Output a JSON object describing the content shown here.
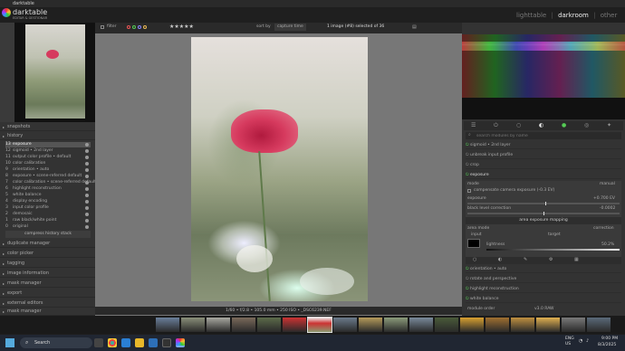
{
  "window": {
    "title": "darktable"
  },
  "app": {
    "name": "darktable",
    "subtitle": "EDITAR & GESTIONAR"
  },
  "views": [
    "lighttable",
    "darkroom",
    "other"
  ],
  "filterbar": {
    "filter_label": "filter",
    "stars": "★★★★★",
    "sort_label": "sort by",
    "sort_value": "capture time",
    "count_text": "1 image (#8) selected of 36"
  },
  "left_panel": {
    "snapshots": "snapshots",
    "history": "history",
    "history_items": [
      {
        "num": "13",
        "label": "exposure"
      },
      {
        "num": "12",
        "label": "sigmoid • 2nd layer"
      },
      {
        "num": "11",
        "label": "output color profile • default"
      },
      {
        "num": "10",
        "label": "color calibration"
      },
      {
        "num": "9",
        "label": "orientation • auto"
      },
      {
        "num": "8",
        "label": "exposure • scene-referred default"
      },
      {
        "num": "7",
        "label": "color calibration • scene-referred default"
      },
      {
        "num": "6",
        "label": "highlight reconstruction"
      },
      {
        "num": "5",
        "label": "white balance"
      },
      {
        "num": "4",
        "label": "display encoding"
      },
      {
        "num": "3",
        "label": "input color profile"
      },
      {
        "num": "2",
        "label": "demosaic"
      },
      {
        "num": "1",
        "label": "raw black/white point"
      },
      {
        "num": "0",
        "label": "original"
      }
    ],
    "compress_button": "compress history stack",
    "modules": [
      "duplicate manager",
      "color picker",
      "tagging",
      "image information",
      "mask manager",
      "export",
      "external editors",
      "mask manager"
    ]
  },
  "right_panel": {
    "search_placeholder": "search modules by name",
    "modules_top": [
      "sigmoid • 2nd layer",
      "unbreak input profile",
      "crop",
      "exposure"
    ],
    "exposure": {
      "mode_label": "mode",
      "mode_value": "manual",
      "compensate_label": "compensate camera exposure (-0.3 EV)",
      "exposure_label": "exposure",
      "exposure_value": "+0.700 EV",
      "black_label": "black level correction",
      "black_value": "-0.0002",
      "area_header": "area exposure mapping",
      "area_mode_label": "area mode",
      "area_mode_value": "correction",
      "input_label": "input",
      "target_label": "target",
      "lightness_label": "lightness",
      "lightness_value": "50.2%"
    },
    "modules_bottom": [
      "orientation • auto",
      "rotate and perspective",
      "highlight reconstruction",
      "white balance"
    ],
    "module_order_label": "module order",
    "module_order_value": "v3.0 RAW"
  },
  "infobar": {
    "text": "1/60 • f/2.8 • 105.0 mm • 250 ISO • _DSC6239.NEF"
  },
  "taskbar": {
    "search_label": "Search",
    "lang": "ENG",
    "region": "US",
    "time": "9:00 PM",
    "date": "8/3/2025"
  },
  "colors": {
    "accent": "#d63a5e",
    "panel": "#333333",
    "center_bg": "#777777",
    "taskbar": "#202632"
  }
}
